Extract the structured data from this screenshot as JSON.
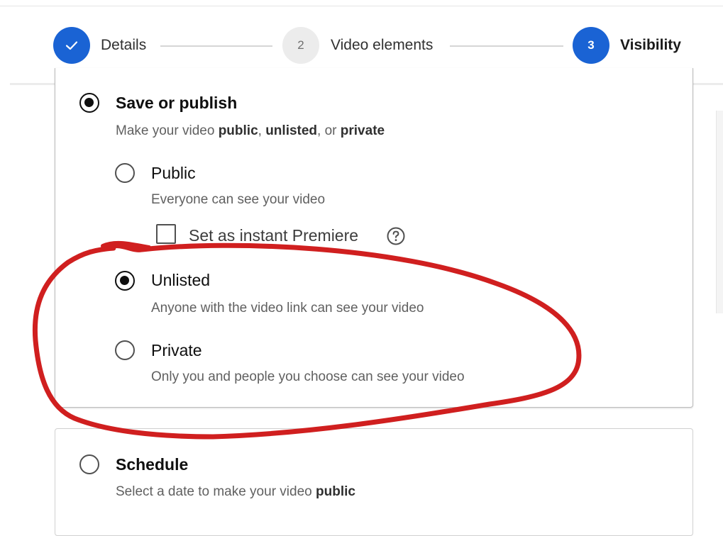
{
  "stepper": {
    "steps": [
      {
        "label": "Details",
        "number": "",
        "state": "done"
      },
      {
        "label": "Video elements",
        "number": "2",
        "state": "pending"
      },
      {
        "label": "Visibility",
        "number": "3",
        "state": "active"
      }
    ]
  },
  "save_publish": {
    "title": "Save or publish",
    "desc": {
      "prefix": "Make your video ",
      "public": "public",
      "sep1": ", ",
      "unlisted": "unlisted",
      "sep2": ", or ",
      "private": "private"
    },
    "selected": true,
    "options": [
      {
        "label": "Public",
        "desc": "Everyone can see your video",
        "selected": false
      },
      {
        "label": "Unlisted",
        "desc": "Anyone with the video link can see your video",
        "selected": true
      },
      {
        "label": "Private",
        "desc": "Only you and people you choose can see your video",
        "selected": false
      }
    ],
    "premiere": {
      "label": "Set as instant Premiere",
      "checked": false
    }
  },
  "schedule": {
    "title": "Schedule",
    "desc": {
      "prefix": "Select a date to make your video ",
      "public": "public"
    },
    "selected": false
  },
  "icons": {
    "step_done": "check-icon",
    "help": "help-circle-icon"
  },
  "colors": {
    "accent": "#1a63d4",
    "annotation": "#d01f1f",
    "muted_text": "#606060"
  }
}
